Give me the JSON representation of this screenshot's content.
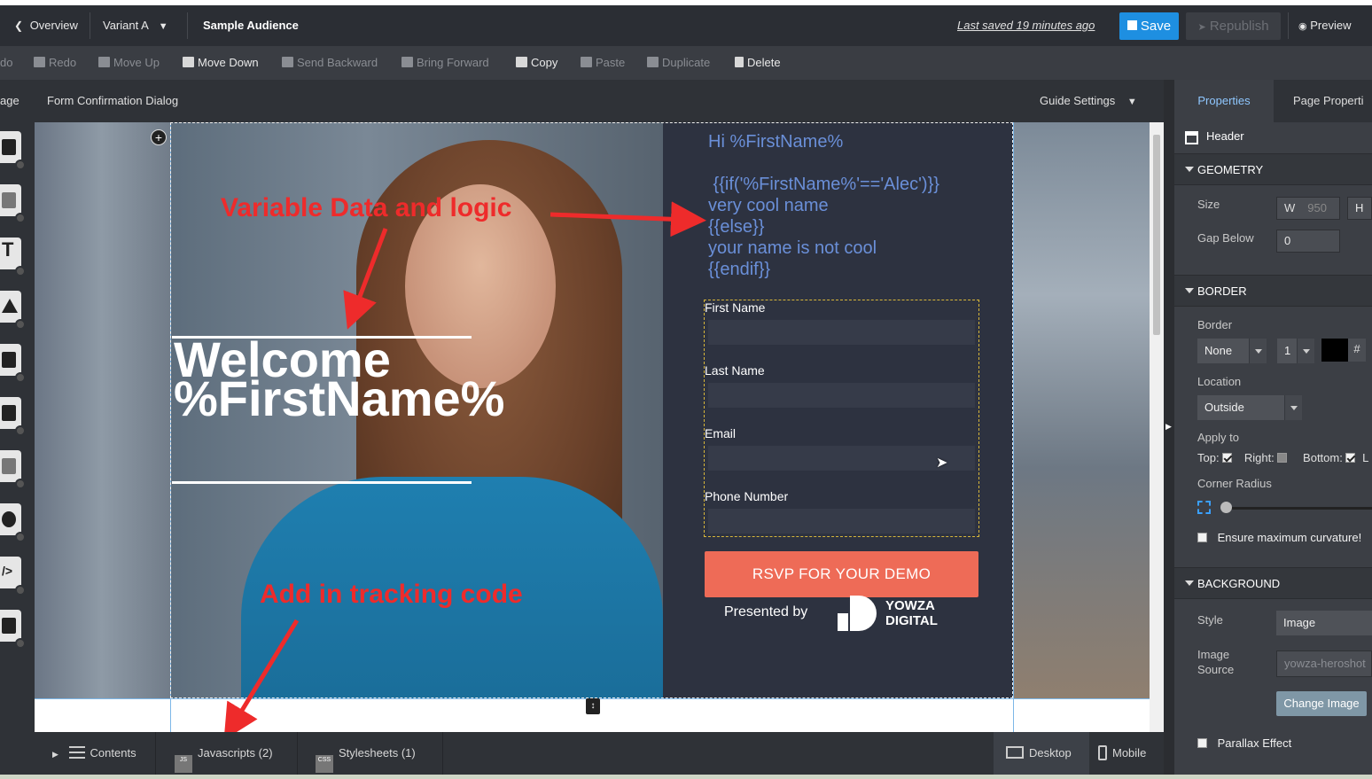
{
  "topbar": {
    "overview": "Overview",
    "variant": "Variant A",
    "audience": "Sample Audience",
    "last_saved": "Last saved 19 minutes ago",
    "save": "Save",
    "republish": "Republish",
    "preview": "Preview"
  },
  "toolbar": {
    "undo": "do",
    "redo": "Redo",
    "move_up": "Move Up",
    "move_down": "Move Down",
    "send_backward": "Send Backward",
    "bring_forward": "Bring Forward",
    "copy": "Copy",
    "paste": "Paste",
    "duplicate": "Duplicate",
    "delete": "Delete"
  },
  "subhead": {
    "page_tab": "age",
    "dialog": "Form Confirmation Dialog",
    "guide_settings": "Guide Settings"
  },
  "canvas": {
    "annotation_logic": "Variable Data and logic",
    "annotation_tracking": "Add in tracking code",
    "welcome_line1": "Welcome",
    "welcome_line2": "%FirstName%",
    "logic_text": "Hi %FirstName%\n\n {{if('%FirstName%'=='Alec')}}\nvery cool name\n{{else}}\nyour name is not cool\n{{endif}}",
    "form": {
      "first_name": "First Name",
      "last_name": "Last Name",
      "email": "Email",
      "phone": "Phone Number"
    },
    "rsvp": "RSVP FOR YOUR DEMO",
    "presented_by": "Presented by",
    "logo_line1": "YOWZA",
    "logo_line2": "DIGITAL"
  },
  "bottombar": {
    "contents": "Contents",
    "javascripts": "Javascripts",
    "javascripts_count": "(2)",
    "stylesheets": "Stylesheets",
    "stylesheets_count": "(1)",
    "desktop": "Desktop",
    "mobile": "Mobile"
  },
  "panel": {
    "tab_properties": "Properties",
    "tab_page_properties": "Page Properti",
    "element": "Header",
    "geometry": "GEOMETRY",
    "size": "Size",
    "w_label": "W",
    "w_value": "950",
    "h_label": "H",
    "gap_below": "Gap Below",
    "gap_value": "0",
    "border_section": "BORDER",
    "border": "Border",
    "border_style": "None",
    "border_width": "1",
    "hash": "#",
    "location": "Location",
    "location_value": "Outside",
    "apply_to": "Apply to",
    "top": "Top:",
    "right": "Right:",
    "bottom": "Bottom:",
    "left_cut": "L",
    "corner_radius": "Corner Radius",
    "ensure_max": "Ensure maximum curvature!",
    "background_section": "BACKGROUND",
    "style": "Style",
    "style_value": "Image",
    "image_source_1": "Image",
    "image_source_2": "Source",
    "image_source_value": "yowza-heroshot",
    "change_image": "Change Image",
    "parallax": "Parallax Effect"
  }
}
